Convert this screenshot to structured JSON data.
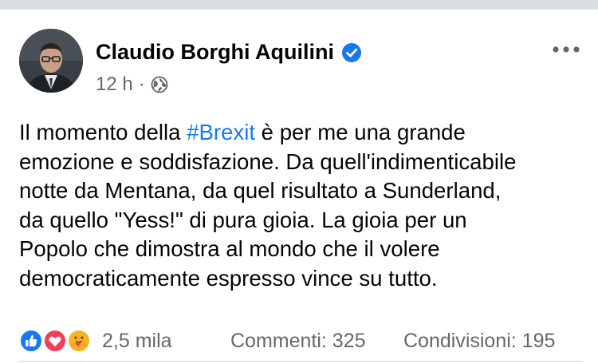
{
  "post": {
    "author": "Claudio Borghi Aquilini",
    "timestamp": "12 h",
    "separator": "·",
    "verified": true,
    "audience_icon": "globe-icon",
    "text_lines": [
      {
        "pre": "Il momento della ",
        "hashtag": "#Brexit",
        "post": " è per me una grande"
      },
      {
        "text": "emozione e soddisfazione. Da quell'indimenticabile"
      },
      {
        "text": "notte da Mentana, da quel risultato a Sunderland,"
      },
      {
        "text": "da quello \"Yess!\" di pura gioia. La gioia per un"
      },
      {
        "text": "Popolo che dimostra al mondo che il volere"
      },
      {
        "text": "democraticamente espresso vince su tutto."
      }
    ]
  },
  "stats": {
    "reactions": [
      "like-reaction-icon",
      "love-reaction-icon",
      "care-reaction-icon"
    ],
    "reaction_count": "2,5 mila",
    "comments": "Commenti: 325",
    "shares": "Condivisioni: 195"
  },
  "colors": {
    "link": "#1877f2",
    "secondary_text": "#65676b",
    "love": "#f33e58",
    "care": "#f7b125"
  }
}
